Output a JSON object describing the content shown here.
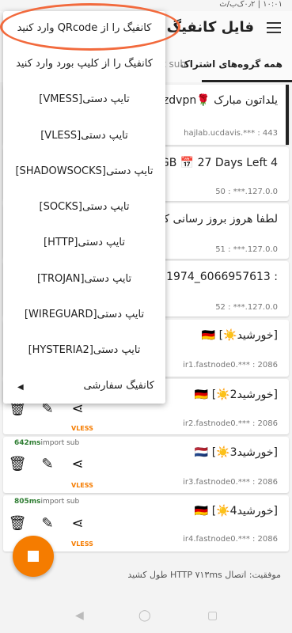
{
  "status": {
    "text": "۱۰:۰۱ | ۰٫۲ک‌ب/ث"
  },
  "appbar": {
    "title": "فایل کانفیگ"
  },
  "tabs": [
    {
      "label": "همه گروه‌های اشتراک"
    },
    {
      "label": "t sub"
    }
  ],
  "menu": {
    "items": [
      {
        "label": "کانفیگ را از QRcode وارد کنید"
      },
      {
        "label": "کانفیگ را از کلیپ بورد وارد کنید"
      },
      {
        "label": "تایپ دستی[VMESS]"
      },
      {
        "label": "تایپ دستی[VLESS]"
      },
      {
        "label": "تایپ دستی[SHADOWSOCKS]"
      },
      {
        "label": "تایپ دستی[SOCKS]"
      },
      {
        "label": "تایپ دستی[HTTP]"
      },
      {
        "label": "تایپ دستی[TROJAN]"
      },
      {
        "label": "تایپ دستی[WIREGUARD]"
      },
      {
        "label": "تایپ دستی[HYSTERIA2]"
      }
    ],
    "submenu": {
      "label": "کانفیگ سفارشی"
    }
  },
  "configs": [
    {
      "name": "یلداتون مبارک 🌹zdvpn",
      "address": "hajlab.ucdavis.*** : 443"
    },
    {
      "name": "4 GB 📅 27 Days Left",
      "address": "50 : ***.127.0.0"
    },
    {
      "name": "لطفا هروز بروز رسانی کنید",
      "address": "51 : ***.127.0.0"
    },
    {
      "name": ": 6066957613_1974",
      "address": "52 : ***.127.0.0"
    },
    {
      "name": "[خورشید☀️] 🇩🇪",
      "address": "ir1.fastnode0.*** : 2086"
    },
    {
      "name": "[خورشید2☀️] 🇩🇪",
      "address": "ir2.fastnode0.*** : 2086",
      "ping": "642ms",
      "sub": "import sub",
      "protocol": "VLESS"
    },
    {
      "name": "[خورشید3☀️] 🇳🇱",
      "address": "ir3.fastnode0.*** : 2086",
      "ping": "805ms",
      "sub": "import sub",
      "protocol": "VLESS"
    },
    {
      "name": "[خورشید4☀️] 🇩🇪",
      "address": "ir4.fastnode0.*** : 2086",
      "protocol": "VLESS"
    }
  ],
  "card1_protocol": "VLESS",
  "footer": {
    "text": "موفقیت: اتصال HTTP ۷۱۳ms طول کشید"
  },
  "colors": {
    "accent": "#f57c00",
    "highlight": "#f26a3d",
    "ping": "#2e7d32"
  },
  "icons": {
    "delete": "delete-icon",
    "edit": "edit-icon",
    "share": "share-icon",
    "menu": "hamburger-icon",
    "stop": "stop-icon"
  }
}
